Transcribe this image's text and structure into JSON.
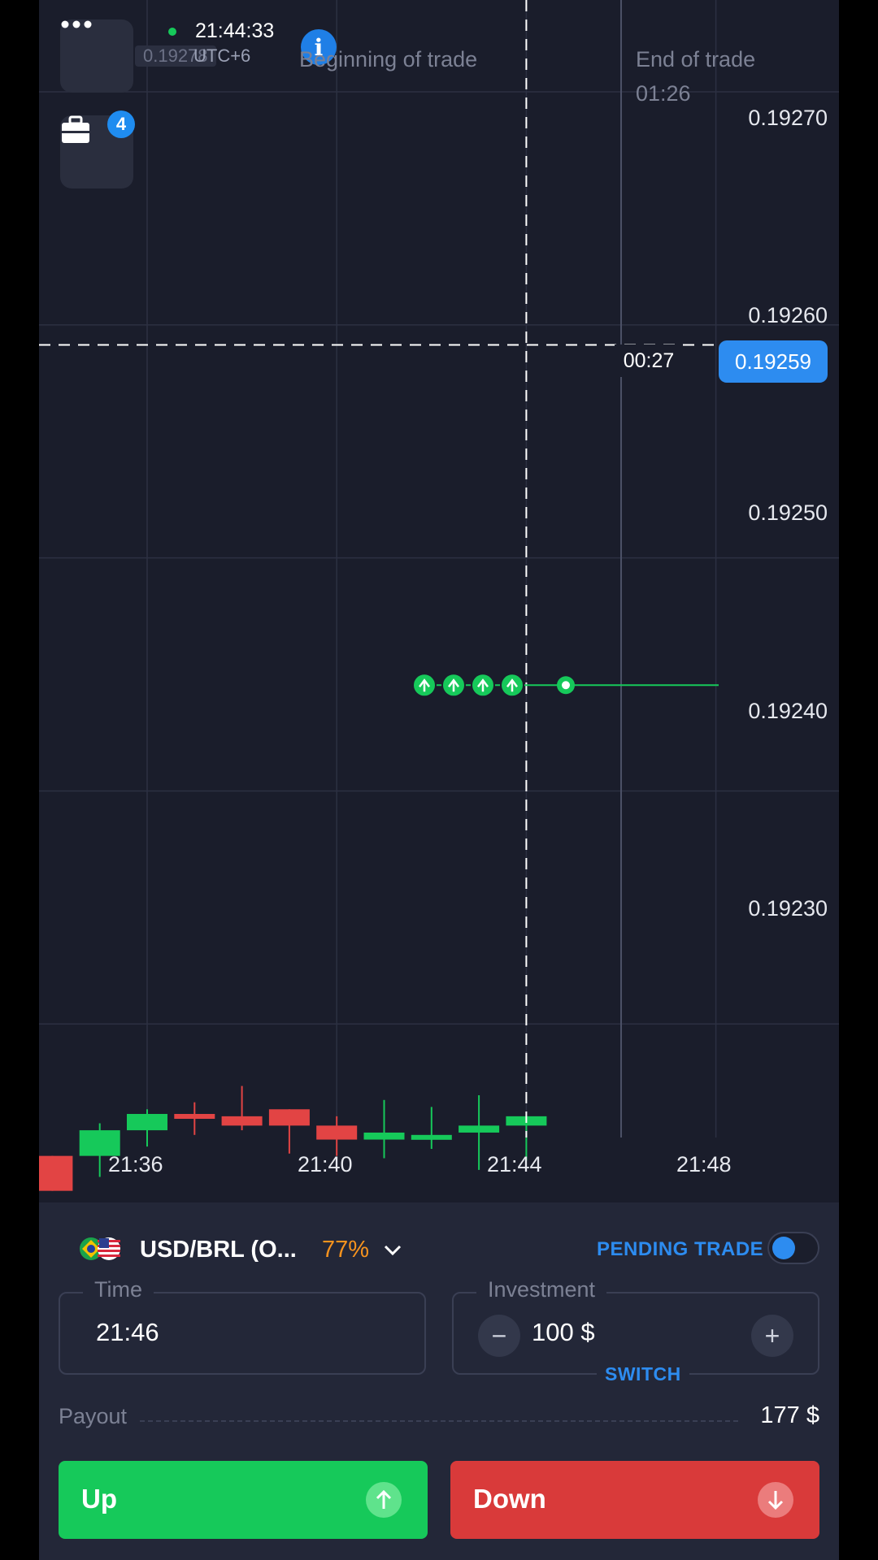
{
  "colors": {
    "up": "#16c95a",
    "down": "#e24444",
    "accent": "#2d8cf0",
    "orange": "#f7931e",
    "background": "#1b1e2c"
  },
  "header": {
    "menu_icon": "ellipsis-icon",
    "portfolio_icon": "briefcase-icon",
    "portfolio_badge": "4",
    "clock": "21:44:33",
    "timezone": "UTC+6",
    "ghost_price": "0.19278",
    "info_icon": "i"
  },
  "trade_markers": {
    "beginning_label": "Beginning of trade",
    "end_label": "End of trade",
    "end_countdown": "01:26"
  },
  "chart_data": {
    "type": "candlestick",
    "y_ticks": [
      "0.19270",
      "0.19260",
      "0.19250",
      "0.19240",
      "0.19230"
    ],
    "x_ticks": [
      "21:36",
      "21:40",
      "21:44",
      "21:48"
    ],
    "current_price": "0.19259",
    "current_timer": "00:27",
    "open_trades_direction": "up",
    "open_trades_count": 4,
    "open_trades_strike": 0.192444,
    "ylim": [
      0.192222,
      0.192738
    ],
    "candles": [
      {
        "t": "21:34",
        "o": 0.192242,
        "c": 0.192227,
        "h": 0.192242,
        "l": 0.192227
      },
      {
        "t": "21:35",
        "o": 0.192242,
        "c": 0.192253,
        "h": 0.192256,
        "l": 0.192233
      },
      {
        "t": "21:36",
        "o": 0.192253,
        "c": 0.19226,
        "h": 0.192262,
        "l": 0.192246
      },
      {
        "t": "21:37",
        "o": 0.19226,
        "c": 0.192258,
        "h": 0.192265,
        "l": 0.192251
      },
      {
        "t": "21:38",
        "o": 0.192259,
        "c": 0.192255,
        "h": 0.192272,
        "l": 0.192253
      },
      {
        "t": "21:39",
        "o": 0.192262,
        "c": 0.192255,
        "h": 0.192262,
        "l": 0.192243
      },
      {
        "t": "21:40",
        "o": 0.192255,
        "c": 0.192249,
        "h": 0.192259,
        "l": 0.192242
      },
      {
        "t": "21:41",
        "o": 0.192249,
        "c": 0.192252,
        "h": 0.192266,
        "l": 0.192241
      },
      {
        "t": "21:42",
        "o": 0.19225,
        "c": 0.192251,
        "h": 0.192263,
        "l": 0.192245
      },
      {
        "t": "21:43",
        "o": 0.192252,
        "c": 0.192255,
        "h": 0.192268,
        "l": 0.192236
      },
      {
        "t": "21:44",
        "o": 0.192255,
        "c": 0.192259,
        "h": 0.192259,
        "l": 0.19224
      }
    ]
  },
  "panel": {
    "asset_name": "USD/BRL (O...",
    "asset_payout_pct": "77%",
    "asset_chevron": "⌄",
    "flags_icon": "brazil-usa-flags-icon",
    "pending_label": "PENDING TRADE",
    "time_title": "Time",
    "time_value": "21:46",
    "investment_title": "Investment",
    "investment_value": "100 $",
    "minus": "−",
    "plus": "+",
    "switch_label": "SWITCH",
    "payout_label": "Payout",
    "payout_value": "177 $",
    "up_label": "Up",
    "down_label": "Down"
  }
}
